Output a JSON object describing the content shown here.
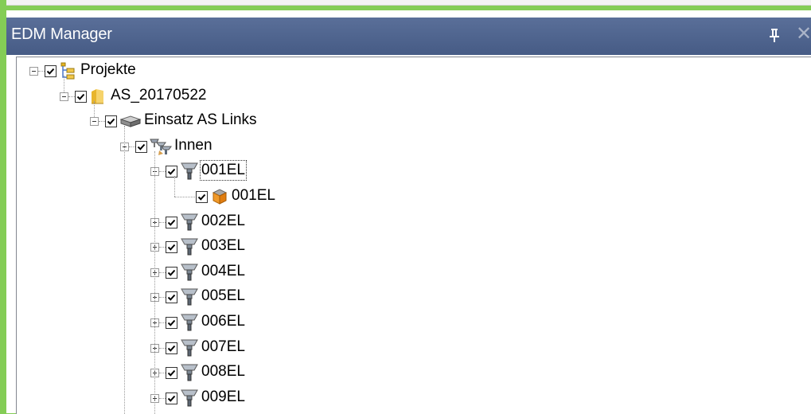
{
  "window": {
    "title": "EDM Manager"
  },
  "tree": {
    "root": {
      "label": "Projekte",
      "checked": true,
      "expanded": true,
      "icon": "project-tree-icon"
    },
    "project": {
      "label": "AS_20170522",
      "checked": true,
      "expanded": true,
      "icon": "folder-icon"
    },
    "insert": {
      "label": "Einsatz AS Links",
      "checked": true,
      "expanded": true,
      "icon": "insert-part-icon"
    },
    "group": {
      "label": "Innen",
      "checked": true,
      "expanded": true,
      "icon": "electrode-group-icon"
    },
    "electrodes": [
      {
        "label": "001EL",
        "checked": true,
        "expanded": true,
        "focused": true,
        "icon": "electrode-icon",
        "children": [
          {
            "label": "001EL",
            "checked": true,
            "icon": "electrode-part-icon"
          }
        ]
      },
      {
        "label": "002EL",
        "checked": true,
        "expanded": false,
        "icon": "electrode-icon"
      },
      {
        "label": "003EL",
        "checked": true,
        "expanded": false,
        "icon": "electrode-icon"
      },
      {
        "label": "004EL",
        "checked": true,
        "expanded": false,
        "icon": "electrode-icon"
      },
      {
        "label": "005EL",
        "checked": true,
        "expanded": false,
        "icon": "electrode-icon"
      },
      {
        "label": "006EL",
        "checked": true,
        "expanded": false,
        "icon": "electrode-icon"
      },
      {
        "label": "007EL",
        "checked": true,
        "expanded": false,
        "icon": "electrode-icon"
      },
      {
        "label": "008EL",
        "checked": true,
        "expanded": false,
        "icon": "electrode-icon"
      },
      {
        "label": "009EL",
        "checked": true,
        "expanded": false,
        "icon": "electrode-icon"
      }
    ]
  }
}
